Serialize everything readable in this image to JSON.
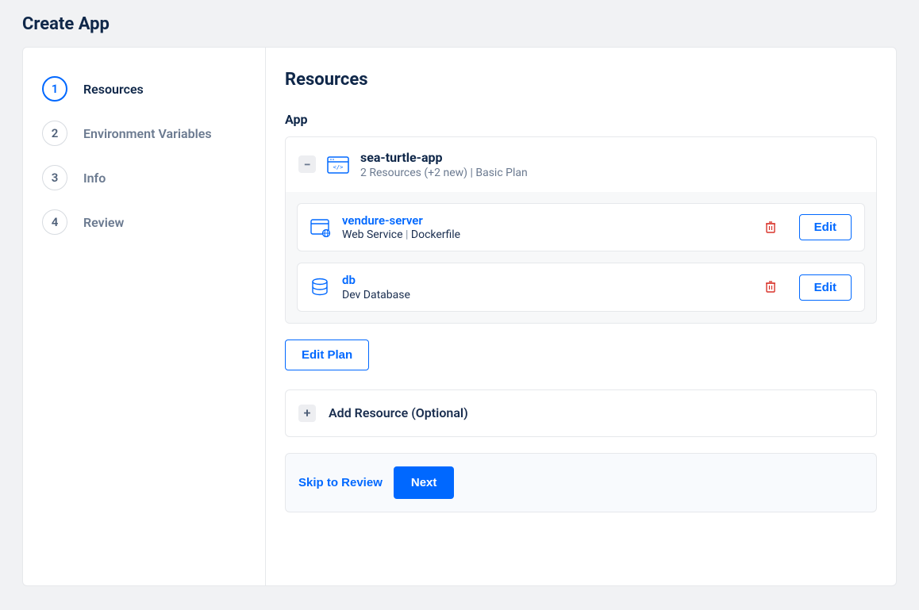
{
  "page": {
    "title": "Create App"
  },
  "steps": [
    {
      "num": "1",
      "label": "Resources",
      "active": true
    },
    {
      "num": "2",
      "label": "Environment Variables",
      "active": false
    },
    {
      "num": "3",
      "label": "Info",
      "active": false
    },
    {
      "num": "4",
      "label": "Review",
      "active": false
    }
  ],
  "main": {
    "heading": "Resources",
    "section_label": "App",
    "app": {
      "name": "sea-turtle-app",
      "meta": "2 Resources (+2 new) | Basic Plan"
    },
    "resources": [
      {
        "name": "vendure-server",
        "type": "Web Service",
        "detail": "Dockerfile",
        "icon": "web-service"
      },
      {
        "name": "db",
        "type": "Dev Database",
        "detail": "",
        "icon": "database"
      }
    ],
    "edit_plan_label": "Edit Plan",
    "edit_label": "Edit",
    "add_resource_label": "Add Resource (Optional)",
    "skip_label": "Skip to Review",
    "next_label": "Next"
  }
}
